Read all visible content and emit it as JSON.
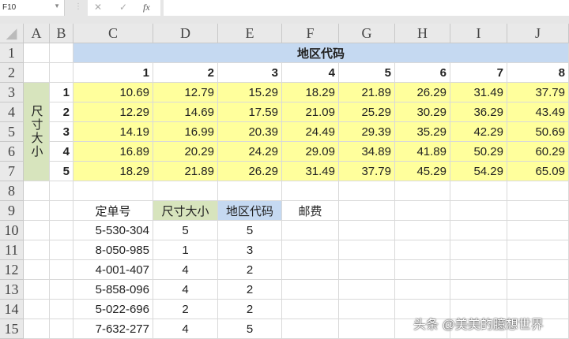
{
  "formula_bar": {
    "name_box": "F10",
    "cancel_icon": "✕",
    "enter_icon": "✓",
    "fx_icon": "fx",
    "formula": ""
  },
  "columns": [
    "A",
    "B",
    "C",
    "D",
    "E",
    "F",
    "G",
    "H",
    "I",
    "J"
  ],
  "rows": [
    "1",
    "2",
    "3",
    "4",
    "5",
    "6",
    "7",
    "8",
    "9",
    "10",
    "11",
    "12",
    "13",
    "14",
    "15"
  ],
  "lookup_table": {
    "title": "地区代码",
    "row_label": "尺寸大小",
    "region_codes": [
      "1",
      "2",
      "3",
      "4",
      "5",
      "6",
      "7",
      "8"
    ],
    "size_codes": [
      "1",
      "2",
      "3",
      "4",
      "5"
    ],
    "values": [
      [
        "10.69",
        "12.79",
        "15.29",
        "18.29",
        "21.89",
        "26.29",
        "31.49",
        "37.79"
      ],
      [
        "12.29",
        "14.69",
        "17.59",
        "21.09",
        "25.29",
        "30.29",
        "36.29",
        "43.49"
      ],
      [
        "14.19",
        "16.99",
        "20.39",
        "24.49",
        "29.39",
        "35.29",
        "42.29",
        "50.69"
      ],
      [
        "16.89",
        "20.29",
        "24.29",
        "29.09",
        "34.89",
        "41.89",
        "50.29",
        "60.29"
      ],
      [
        "18.29",
        "21.89",
        "26.29",
        "31.49",
        "37.79",
        "45.29",
        "54.29",
        "65.09"
      ]
    ]
  },
  "orders": {
    "headers": [
      "定单号",
      "尺寸大小",
      "地区代码",
      "邮费"
    ],
    "rows": [
      [
        "5-530-304",
        "5",
        "5"
      ],
      [
        "8-050-985",
        "1",
        "3"
      ],
      [
        "4-001-407",
        "4",
        "2"
      ],
      [
        "5-858-096",
        "4",
        "2"
      ],
      [
        "5-022-696",
        "2",
        "2"
      ],
      [
        "7-632-277",
        "4",
        "5"
      ]
    ]
  },
  "watermark": "头条 @美美的臆想世界"
}
